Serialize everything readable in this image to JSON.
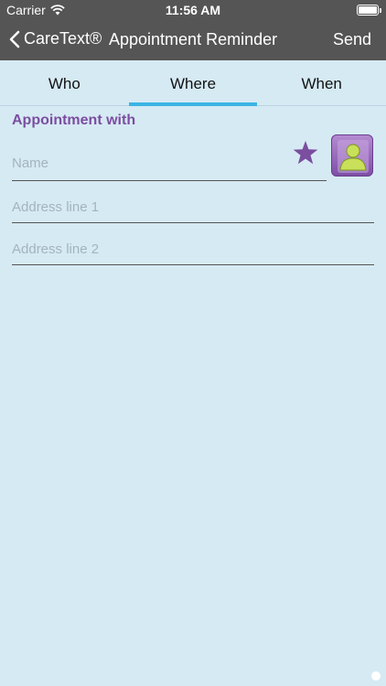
{
  "status_bar": {
    "carrier": "Carrier",
    "time": "11:56 AM"
  },
  "nav": {
    "back_label": "CareText®",
    "title": "Appointment Reminder",
    "send_label": "Send"
  },
  "tabs": [
    {
      "label": "Who",
      "active": false
    },
    {
      "label": "Where",
      "active": true
    },
    {
      "label": "When",
      "active": false
    }
  ],
  "form": {
    "section_title": "Appointment with",
    "name_placeholder": "Name",
    "address1_placeholder": "Address line 1",
    "address2_placeholder": "Address line 2"
  },
  "icons": {
    "wifi": "wifi-icon",
    "battery": "battery-icon",
    "back": "chevron-left-icon",
    "star": "star-icon",
    "contact": "contact-person-icon"
  },
  "colors": {
    "nav_bg": "#555555",
    "page_bg": "#d6eaf4",
    "accent_tab": "#3bb4e5",
    "purple": "#7b4ea0"
  }
}
